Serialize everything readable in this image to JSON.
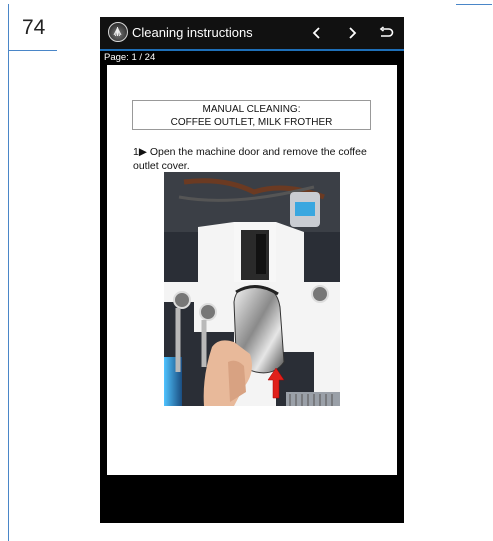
{
  "page": {
    "number": "74"
  },
  "app": {
    "title": "Cleaning instructions",
    "page_indicator": "Page: 1 / 24",
    "icons": [
      "app-logo-icon",
      "chevron-left-icon",
      "chevron-right-icon",
      "back-arrow-icon",
      "red-arrow-up-icon"
    ]
  },
  "doc": {
    "heading_line1": "MANUAL CLEANING:",
    "heading_line2": "COFFEE OUTLET, MILK FROTHER",
    "step": "1▶ Open the machine door and remove the coffee outlet cover."
  },
  "colors": {
    "accent": "#1e6fb8",
    "rule": "#4a86c8",
    "arrow": "#e0201a"
  }
}
